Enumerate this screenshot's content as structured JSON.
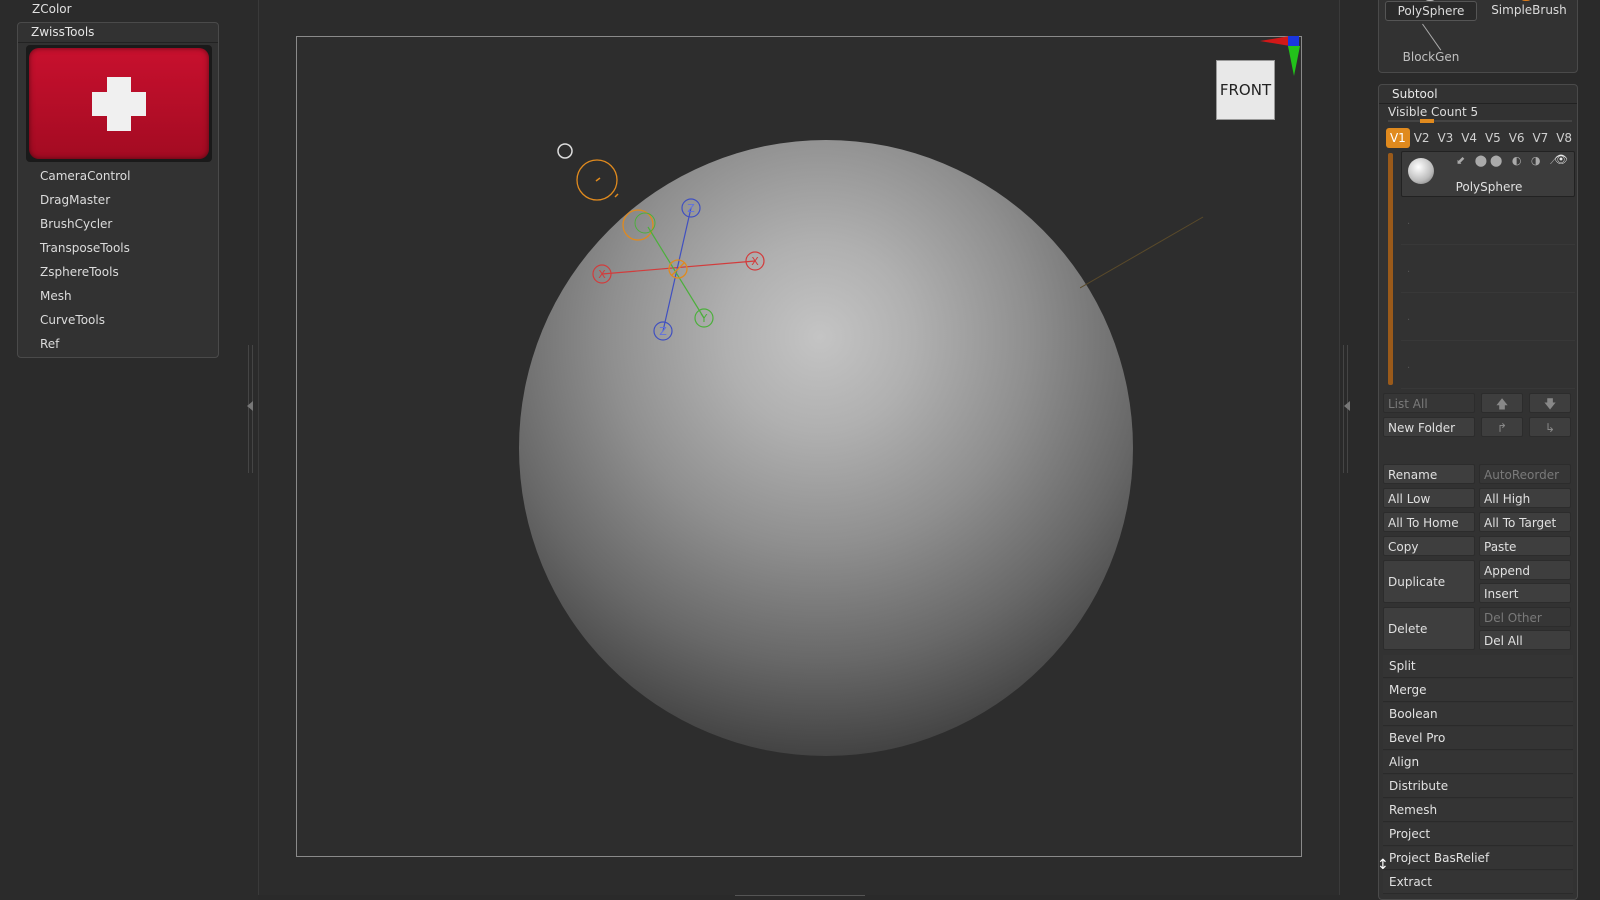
{
  "left": {
    "zcolor_label": "ZColor",
    "zwiss_title": "ZwissTools",
    "items": [
      "CameraControl",
      "DragMaster",
      "BrushCycler",
      "TransposeTools",
      "ZsphereTools",
      "Mesh",
      "CurveTools",
      "Ref"
    ]
  },
  "canvas": {
    "nav_cube_label": "FRONT",
    "gizmo_axes": {
      "x": "X",
      "y": "Y",
      "z": "Z"
    }
  },
  "tool": {
    "current": "PolySphere",
    "other": "SimpleBrush",
    "child": "BlockGen"
  },
  "subtool": {
    "title": "Subtool",
    "visible_count_label": "Visible Count 5",
    "visible_count": 5,
    "tabs": [
      "V1",
      "V2",
      "V3",
      "V4",
      "V5",
      "V6",
      "V7",
      "V8"
    ],
    "active_tab": "V1",
    "item_name": "PolySphere",
    "buttons": {
      "list_all": "List All",
      "new_folder": "New Folder",
      "rename": "Rename",
      "auto_reorder": "AutoReorder",
      "all_low": "All Low",
      "all_high": "All High",
      "all_to_home": "All To Home",
      "all_to_target": "All To Target",
      "copy": "Copy",
      "paste": "Paste",
      "duplicate": "Duplicate",
      "append": "Append",
      "insert": "Insert",
      "delete": "Delete",
      "del_other": "Del Other",
      "del_all": "Del All"
    },
    "sections": [
      "Split",
      "Merge",
      "Boolean",
      "Bevel Pro",
      "Align",
      "Distribute",
      "Remesh",
      "Project",
      "Project BasRelief",
      "Extract"
    ]
  },
  "colors": {
    "accent": "#e08a1e",
    "flag_red": "#c8102e",
    "gizmo_x": "#d23c3c",
    "gizmo_y": "#4caf3c",
    "gizmo_z": "#4050c0",
    "gizmo_center": "#e08a1e"
  }
}
